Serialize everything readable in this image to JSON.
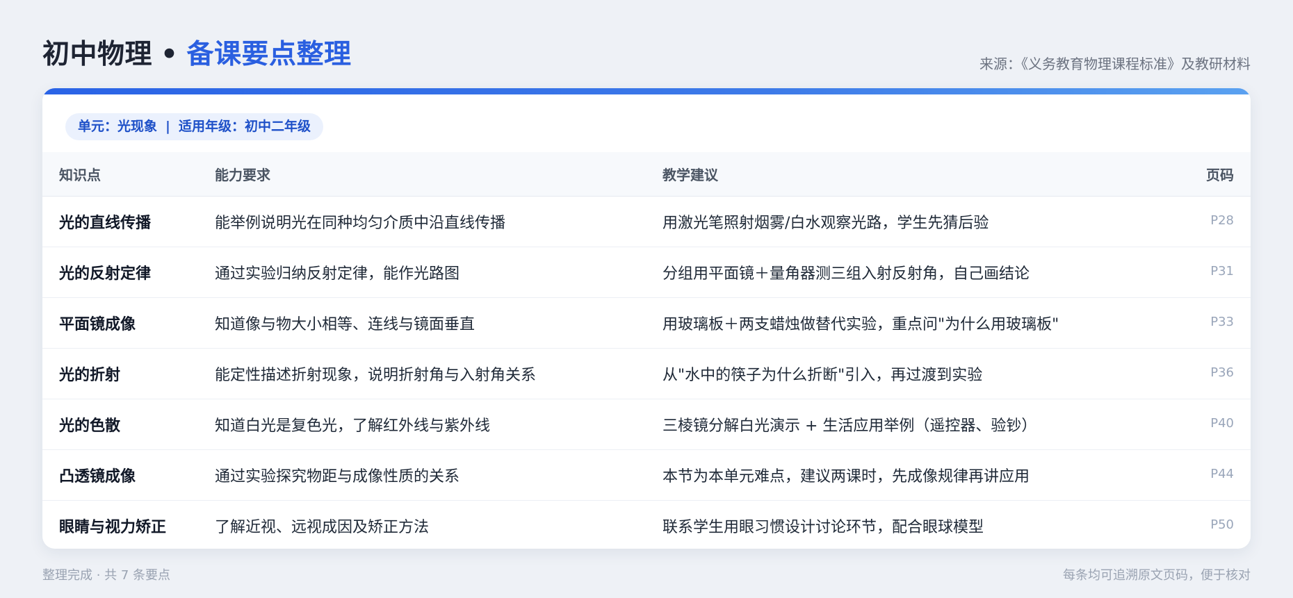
{
  "header": {
    "title_main": "初中物理",
    "title_dot": "•",
    "title_accent": "备课要点整理",
    "source": "来源：《义务教育物理课程标准》及教研材料"
  },
  "card": {
    "unit": "单元：光现象",
    "separator": "|",
    "grade": "适用年级：初中二年级"
  },
  "table": {
    "columns": [
      "知识点",
      "能力要求",
      "教学建议",
      "页码"
    ],
    "rows": [
      {
        "topic": "光的直线传播",
        "requirement": "能举例说明光在同种均匀介质中沿直线传播",
        "suggestion": "用激光笔照射烟雾/白水观察光路，学生先猜后验",
        "page": "P28"
      },
      {
        "topic": "光的反射定律",
        "requirement": "通过实验归纳反射定律，能作光路图",
        "suggestion": "分组用平面镜＋量角器测三组入射反射角，自己画结论",
        "page": "P31"
      },
      {
        "topic": "平面镜成像",
        "requirement": "知道像与物大小相等、连线与镜面垂直",
        "suggestion": "用玻璃板＋两支蜡烛做替代实验，重点问\"为什么用玻璃板\"",
        "page": "P33"
      },
      {
        "topic": "光的折射",
        "requirement": "能定性描述折射现象，说明折射角与入射角关系",
        "suggestion": "从\"水中的筷子为什么折断\"引入，再过渡到实验",
        "page": "P36"
      },
      {
        "topic": "光的色散",
        "requirement": "知道白光是复色光，了解红外线与紫外线",
        "suggestion": "三棱镜分解白光演示 + 生活应用举例（遥控器、验钞）",
        "page": "P40"
      },
      {
        "topic": "凸透镜成像",
        "requirement": "通过实验探究物距与成像性质的关系",
        "suggestion": "本节为本单元难点，建议两课时，先成像规律再讲应用",
        "page": "P44"
      },
      {
        "topic": "眼睛与视力矫正",
        "requirement": "了解近视、远视成因及矫正方法",
        "suggestion": "联系学生用眼习惯设计讨论环节，配合眼球模型",
        "page": "P50"
      }
    ]
  },
  "footer": {
    "left": "整理完成 · 共 7 条要点",
    "right": "每条均可追溯原文页码，便于核对"
  },
  "colors": {
    "accent": "#2a5fe0",
    "background": "#eef1f6",
    "pill_bg": "#ebf1fd",
    "pill_text": "#1e50c8"
  }
}
